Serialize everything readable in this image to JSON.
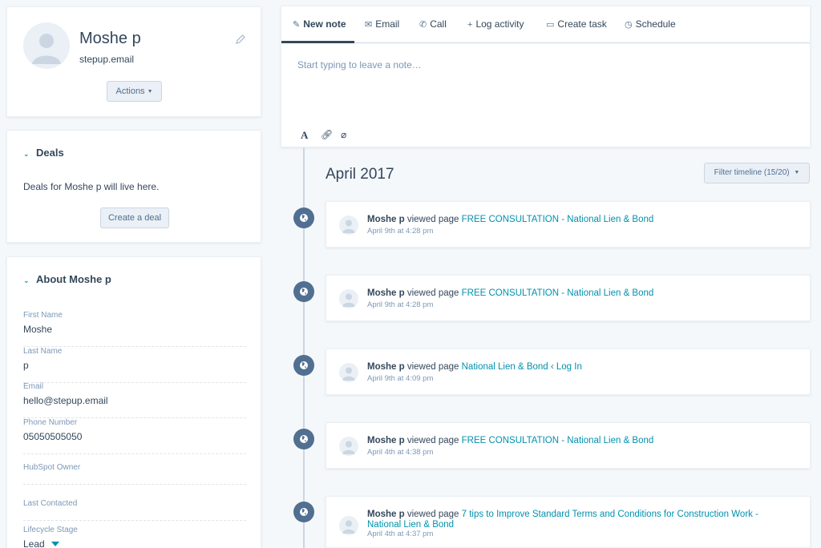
{
  "contact": {
    "name": "Moshe p",
    "domain": "stepup.email",
    "actions_label": "Actions"
  },
  "deals": {
    "title": "Deals",
    "empty_text": "Deals for Moshe p will live here.",
    "create_label": "Create a deal"
  },
  "about": {
    "title": "About Moshe p",
    "fields": [
      {
        "label": "First Name",
        "value": "Moshe"
      },
      {
        "label": "Last Name",
        "value": "p"
      },
      {
        "label": "Email",
        "value": "hello@stepup.email"
      },
      {
        "label": "Phone Number",
        "value": "05050505050"
      },
      {
        "label": "HubSpot Owner",
        "value": ""
      },
      {
        "label": "Last Contacted",
        "value": ""
      },
      {
        "label": "Lifecycle Stage",
        "value": "Lead"
      }
    ]
  },
  "composer": {
    "tabs": [
      {
        "label": "New note",
        "icon": "edit-icon"
      },
      {
        "label": "Email",
        "icon": "envelope-icon"
      },
      {
        "label": "Call",
        "icon": "phone-icon"
      },
      {
        "label": "Log activity",
        "icon": "plus-icon"
      },
      {
        "label": "Create task",
        "icon": "task-icon"
      },
      {
        "label": "Schedule",
        "icon": "clock-icon"
      }
    ],
    "placeholder": "Start typing to leave a note…",
    "tools": [
      "text-format-icon",
      "link-icon",
      "attachment-icon"
    ]
  },
  "timeline": {
    "month": "April 2017",
    "filter_label": "Filter timeline (15/20)",
    "events": [
      {
        "actor": "Moshe p",
        "action": "viewed page",
        "link": "FREE CONSULTATION - National Lien & Bond",
        "time": "April 9th at 4:28 pm"
      },
      {
        "actor": "Moshe p",
        "action": "viewed page",
        "link": "FREE CONSULTATION - National Lien & Bond",
        "time": "April 9th at 4:28 pm"
      },
      {
        "actor": "Moshe p",
        "action": "viewed page",
        "link": "National Lien & Bond ‹ Log In",
        "time": "April 9th at 4:09 pm"
      },
      {
        "actor": "Moshe p",
        "action": "viewed page",
        "link": "FREE CONSULTATION - National Lien & Bond",
        "time": "April 4th at 4:38 pm"
      },
      {
        "actor": "Moshe p",
        "action": "viewed page",
        "link": "7 tips to Improve Standard Terms and Conditions for Construction Work - National Lien & Bond",
        "time": "April 4th at 4:37 pm"
      }
    ]
  },
  "colors": {
    "text": "#33475b",
    "link": "#0091ae",
    "muted": "#7c98b6",
    "background": "#f5f8fa",
    "timeline_dot": "#516f90"
  }
}
